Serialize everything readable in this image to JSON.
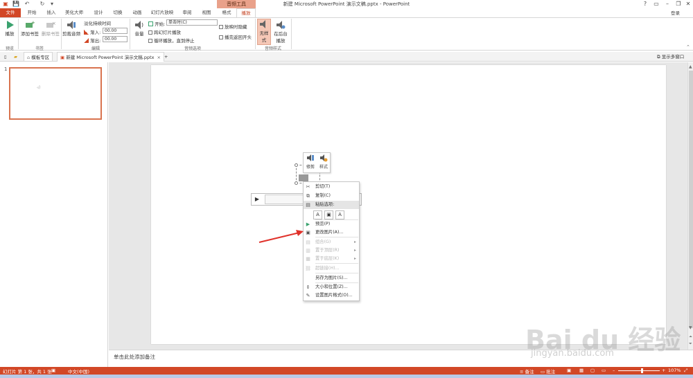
{
  "window": {
    "title": "新建 Microsoft PowerPoint 演示文稿.pptx - PowerPoint",
    "context_band": "音频工具",
    "login": "登录"
  },
  "tabs": [
    "文件",
    "开始",
    "插入",
    "美化大师",
    "设计",
    "切换",
    "动画",
    "幻灯片放映",
    "审阅",
    "视图",
    "格式",
    "播放"
  ],
  "ribbon": {
    "preview_btn": "播放",
    "add_bookmark": "添加书签",
    "remove_bookmark": "删除书签",
    "trim_audio": "剪裁音频",
    "fade_duration": "淡化持续时间",
    "fade_in_label": "渐入:",
    "fade_in_value": "00.00",
    "fade_out_label": "渐出:",
    "fade_out_value": "00.00",
    "volume": "音量",
    "start_label": "开始:",
    "start_value": "单击时(C)",
    "cross_slides": "跨幻灯片播放",
    "loop": "循环播放，直到停止",
    "hide_during_show": "放映时隐藏",
    "rewind": "播完返回开头",
    "no_style": "无样式",
    "play_bg": "在后台播放",
    "groups": {
      "preview": "预览",
      "bookmarks": "书签",
      "editing": "编辑",
      "audio_options": "音频选项",
      "audio_styles": "音频样式"
    }
  },
  "docbar": {
    "template_tab": "模板专区",
    "doc_tab": "新建 Microsoft PowerPoint 演示文稿.pptx",
    "add": "+",
    "multi_window": "显示多窗口"
  },
  "thumbnail": {
    "number": "1"
  },
  "mini_toolbar": {
    "trim": "修剪",
    "style": "样式"
  },
  "context_menu": {
    "items": [
      {
        "label": "剪切(T)",
        "icon": "✂",
        "disabled": false
      },
      {
        "label": "复制(C)",
        "icon": "⧉",
        "disabled": false
      },
      {
        "label": "粘贴选项:",
        "icon": "📋",
        "disabled": false
      },
      {
        "label": "预览(P)",
        "icon": "▶",
        "disabled": false
      },
      {
        "label": "更改图片(A)...",
        "icon": "▣",
        "disabled": false
      },
      {
        "label": "组合(G)",
        "icon": "▤",
        "disabled": true
      },
      {
        "label": "置于顶层(R)",
        "icon": "▥",
        "disabled": true
      },
      {
        "label": "置于底层(K)",
        "icon": "▦",
        "disabled": true
      },
      {
        "label": "超链接(H)...",
        "icon": "⛓",
        "disabled": true
      },
      {
        "label": "另存为图片(S)...",
        "icon": "",
        "disabled": false
      },
      {
        "label": "大小和位置(Z)...",
        "icon": "⇕",
        "disabled": false
      },
      {
        "label": "设置图片格式(O)...",
        "icon": "✎",
        "disabled": false
      }
    ]
  },
  "notes": {
    "placeholder": "单击此处添加备注"
  },
  "status": {
    "slide_info": "幻灯片 第 1 张，共 1 张",
    "language": "中文(中国)",
    "notes": "备注",
    "comments": "批注",
    "zoom": "107%"
  },
  "watermark": {
    "main": "Bai du 经验",
    "url": "jingyan.baidu.com"
  },
  "colors": {
    "accent": "#d24726",
    "context": "#e9a18a",
    "arrow": "#e0322b"
  }
}
